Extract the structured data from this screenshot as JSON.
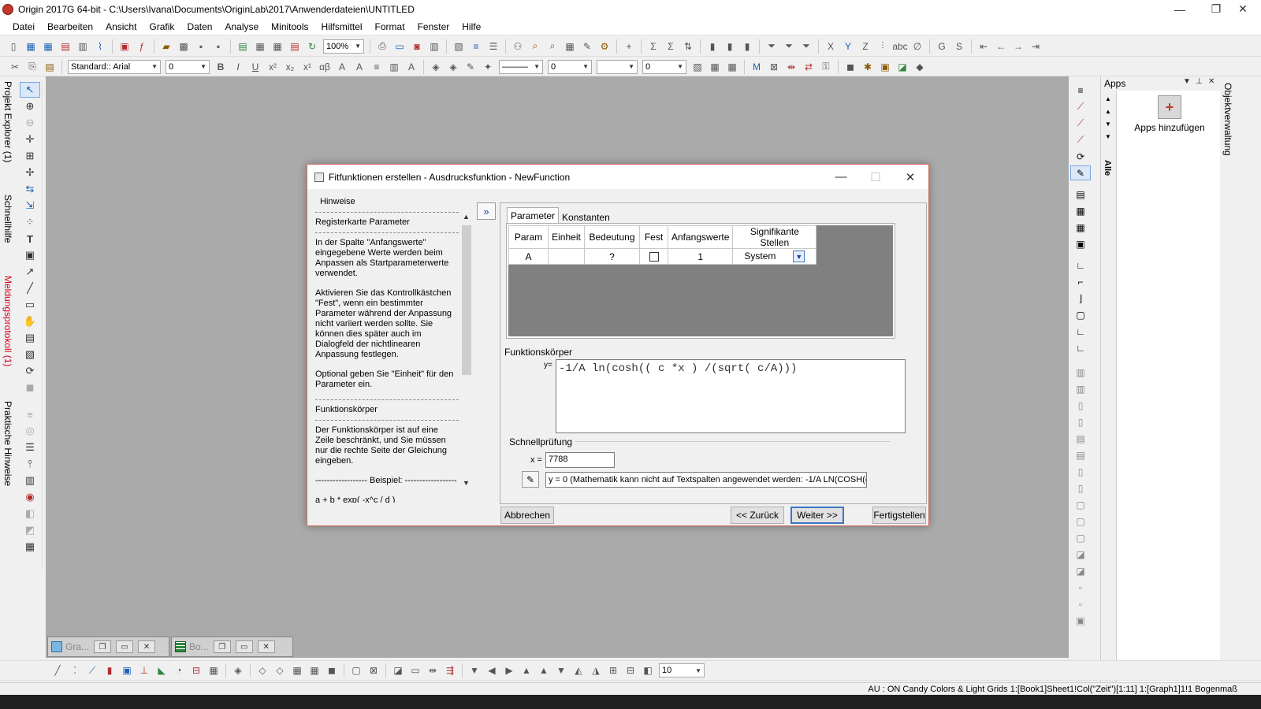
{
  "window": {
    "title": "Origin 2017G 64-bit - C:\\Users\\Ivana\\Documents\\OriginLab\\2017\\Anwenderdateien\\UNTITLED",
    "min": "—",
    "restore": "❐",
    "close": "✕"
  },
  "menu": [
    "Datei",
    "Bearbeiten",
    "Ansicht",
    "Grafik",
    "Daten",
    "Analyse",
    "Minitools",
    "Hilfsmittel",
    "Format",
    "Fenster",
    "Hilfe"
  ],
  "toolbar1": {
    "zoom_value": "100%"
  },
  "toolbar2": {
    "font_value": "Standard:: Arial",
    "font_size_value": "0",
    "line_width_value": "0",
    "value3": "0"
  },
  "left_tabs": [
    "Projekt Explorer (1)",
    "Schnellhilfe",
    "Meldungsprotokoll (1)",
    "Praktische Hinweise"
  ],
  "apps_panel": {
    "title": "Apps",
    "tab_label": "Alle",
    "add_app_label": "Apps hinzufügen",
    "side_tab": "Objektverwaltung"
  },
  "minimized_windows": [
    {
      "label": "Gra..."
    },
    {
      "label": "Bo..."
    }
  ],
  "bottom_toolbar": {
    "size_value": "10"
  },
  "statusbar": {
    "text": "AU : ON  Candy Colors & Light Grids  1:[Book1]Sheet1!Col(\"Zeit\")[1:11]  1:[Graph1]1!1  Bogenmaß"
  },
  "dialog": {
    "title": "Fitfunktionen erstellen - Ausdrucksfunktion - NewFunction",
    "hints": {
      "heading": "Hinweise",
      "section1_title": "Registerkarte Parameter",
      "para1": "In der Spalte \"Anfangswerte\" eingegebene Werte werden beim Anpassen als Startparameterwerte verwendet.",
      "para2": "Aktivieren Sie das Kontrollkästchen \"Fest\", wenn ein bestimmter Parameter während der Anpassung nicht variiert werden sollte. Sie können dies später auch im Dialogfeld der nichtlinearen Anpassung festlegen.",
      "para3": "Optional geben Sie \"Einheit\" für den Parameter ein.",
      "section2_title": "Funktionskörper",
      "para4": "Der Funktionskörper ist auf eine Zeile beschränkt, und Sie müssen nur die rechte Seite der Gleichung eingeben.",
      "example_label": "------------------ Beispiel: ------------------",
      "example": "a + b * exp( -x^c / d )"
    },
    "expand_button": "»",
    "tabs": [
      "Parameter",
      "Konstanten"
    ],
    "param_table": {
      "headers": [
        "Param",
        "Einheit",
        "Bedeutung",
        "Fest",
        "Anfangswerte",
        "Signifikante Stellen"
      ],
      "rows": [
        {
          "param": "A",
          "einheit": "",
          "bedeutung": "?",
          "fest": false,
          "anfangswert": "1",
          "stellen": "System"
        }
      ]
    },
    "function_body_label": "Funktionskörper",
    "y_label": "y=",
    "function_body": "-1/A ln(cosh(( c *x ) /(sqrt( c/A)))",
    "quickcheck_label": "Schnellprüfung",
    "x_label": "x =",
    "x_value": "7788",
    "result": "y = 0  (Mathematik kann nicht auf Textspalten angewendet werden: -1/A LN(COSH(( C",
    "buttons": {
      "cancel": "Abbrechen",
      "back": "<< Zurück",
      "next": "Weiter >>",
      "finish": "Fertigstellen"
    }
  }
}
